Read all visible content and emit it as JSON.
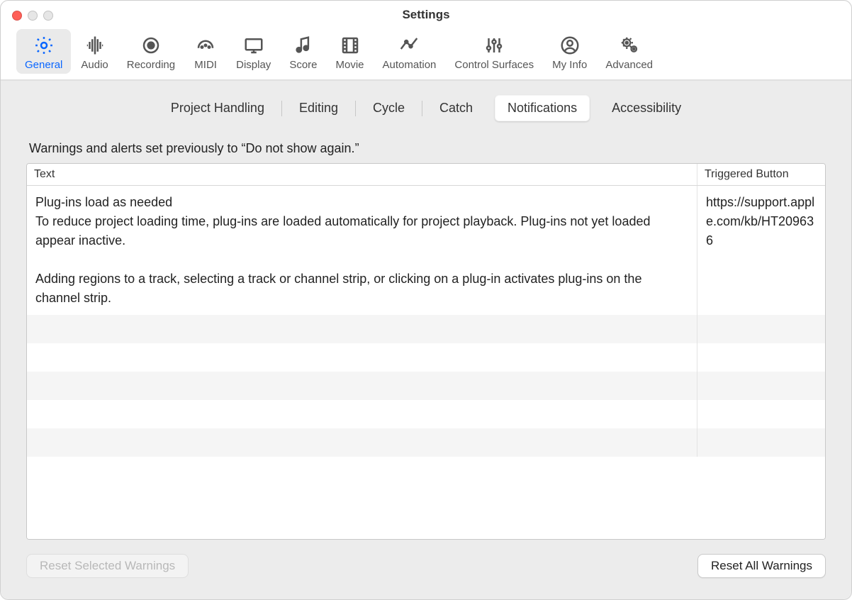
{
  "window": {
    "title": "Settings"
  },
  "toolbar": [
    {
      "id": "general",
      "label": "General",
      "icon": "gear-icon",
      "active": true
    },
    {
      "id": "audio",
      "label": "Audio",
      "icon": "waveform-icon",
      "active": false
    },
    {
      "id": "recording",
      "label": "Recording",
      "icon": "record-icon",
      "active": false
    },
    {
      "id": "midi",
      "label": "MIDI",
      "icon": "midi-icon",
      "active": false
    },
    {
      "id": "display",
      "label": "Display",
      "icon": "display-icon",
      "active": false
    },
    {
      "id": "score",
      "label": "Score",
      "icon": "score-icon",
      "active": false
    },
    {
      "id": "movie",
      "label": "Movie",
      "icon": "film-icon",
      "active": false
    },
    {
      "id": "automation",
      "label": "Automation",
      "icon": "automation-icon",
      "active": false
    },
    {
      "id": "surfaces",
      "label": "Control Surfaces",
      "icon": "sliders-icon",
      "active": false
    },
    {
      "id": "myinfo",
      "label": "My Info",
      "icon": "person-icon",
      "active": false
    },
    {
      "id": "advanced",
      "label": "Advanced",
      "icon": "gears-icon",
      "active": false
    }
  ],
  "tabs": [
    {
      "id": "project",
      "label": "Project Handling",
      "selected": false
    },
    {
      "id": "editing",
      "label": "Editing",
      "selected": false
    },
    {
      "id": "cycle",
      "label": "Cycle",
      "selected": false
    },
    {
      "id": "catch",
      "label": "Catch",
      "selected": false
    },
    {
      "id": "notifications",
      "label": "Notifications",
      "selected": true
    },
    {
      "id": "accessibility",
      "label": "Accessibility",
      "selected": false
    }
  ],
  "description": "Warnings and alerts set previously to “Do not show again.”",
  "table": {
    "headers": {
      "text": "Text",
      "triggered": "Triggered Button"
    },
    "rows": [
      {
        "text": "Plug-ins load as needed\nTo reduce project loading time, plug-ins are loaded automatically for project playback. Plug-ins not yet loaded appear inactive.\n\nAdding regions to a track, selecting a track or channel strip, or clicking on a plug-in activates plug-ins on the channel strip.",
        "triggered": "https://support.apple.com/kb/HT209636"
      },
      {
        "text": "",
        "triggered": ""
      },
      {
        "text": "",
        "triggered": ""
      },
      {
        "text": "",
        "triggered": ""
      },
      {
        "text": "",
        "triggered": ""
      },
      {
        "text": "",
        "triggered": ""
      }
    ]
  },
  "buttons": {
    "reset_selected": "Reset Selected Warnings",
    "reset_all": "Reset All Warnings"
  }
}
